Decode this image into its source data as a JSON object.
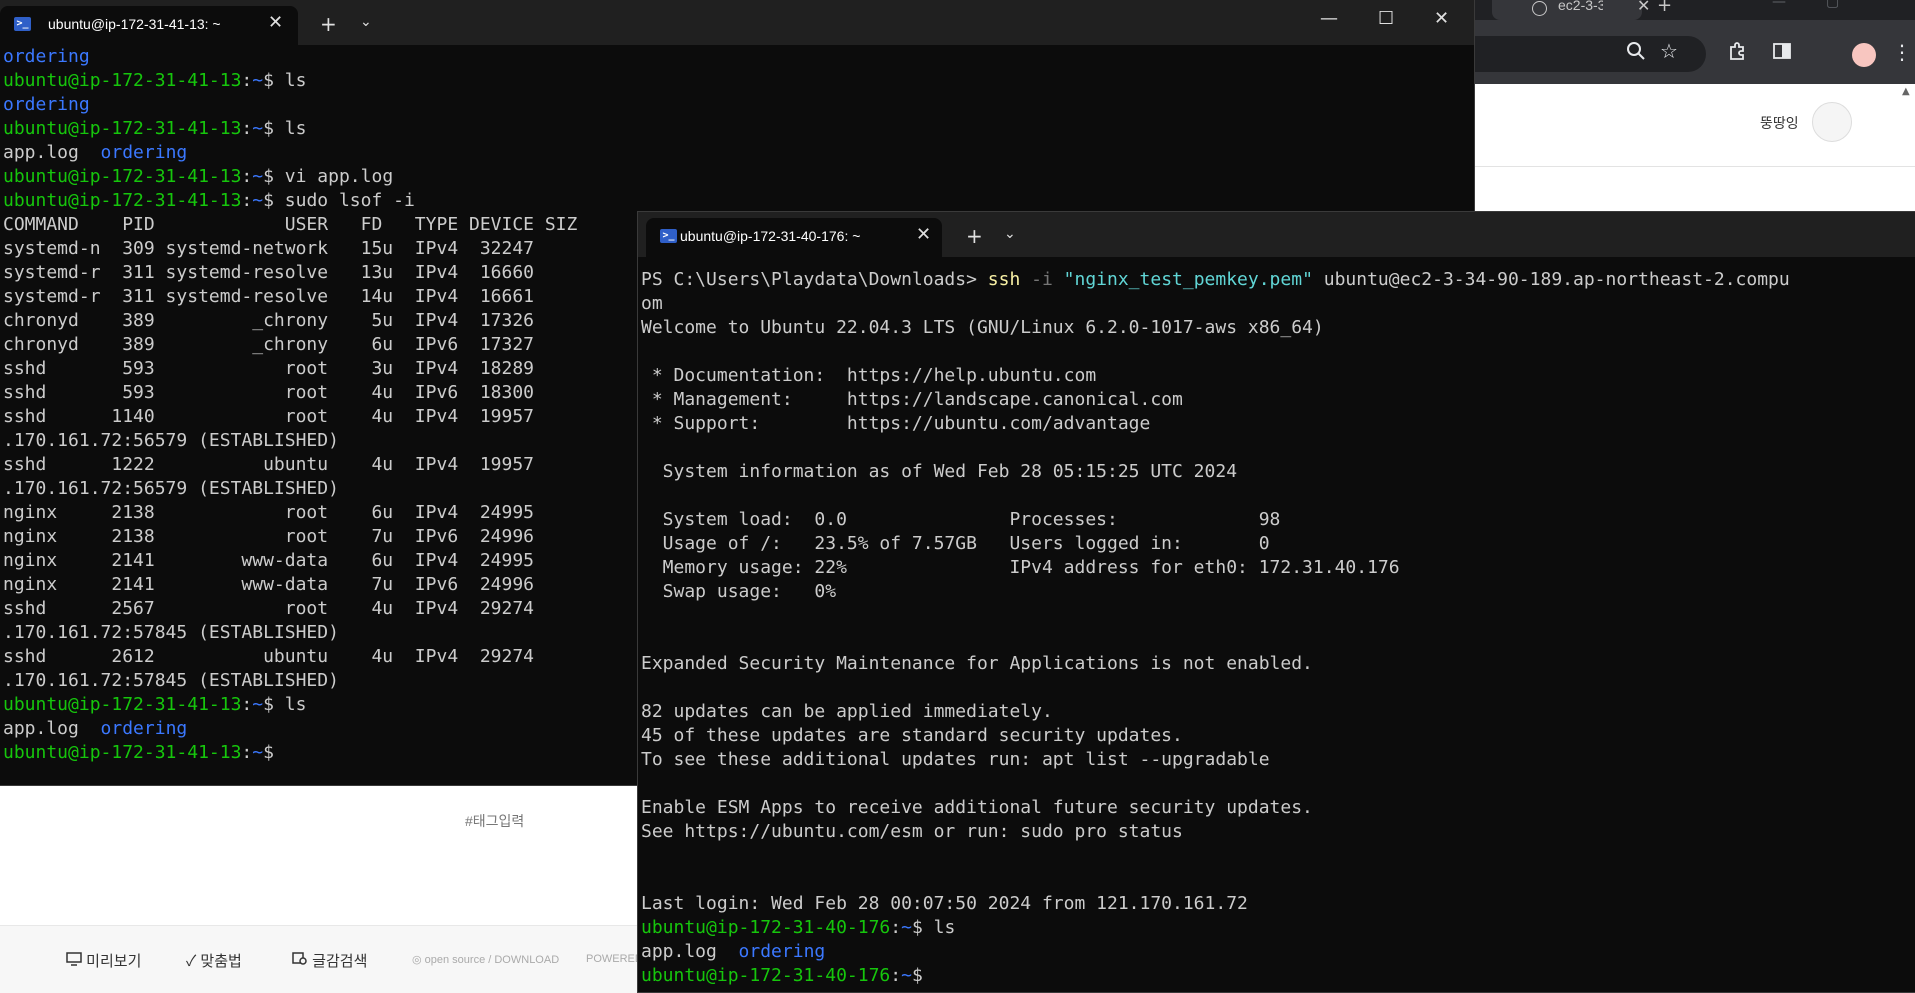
{
  "browser": {
    "tab_title": "ec2-3-3",
    "username": "뚱땅잉",
    "tag_placeholder": "#태그입력",
    "footer": {
      "preview": "미리보기",
      "spellcheck": "맞춤법",
      "search": "글감검색",
      "opensource": "open source / DOWNLOAD",
      "powered": "POWERED"
    }
  },
  "terminal1": {
    "tab_title": "ubuntu@ip-172-31-41-13: ~",
    "lines": [
      [
        {
          "t": "ordering",
          "c": "b"
        }
      ],
      [
        {
          "t": "ubuntu@ip-172-31-41-13",
          "c": "g"
        },
        {
          "t": ":",
          "c": "c"
        },
        {
          "t": "~",
          "c": "b"
        },
        {
          "t": "$ ls",
          "c": "c"
        }
      ],
      [
        {
          "t": "ordering",
          "c": "b"
        }
      ],
      [
        {
          "t": "ubuntu@ip-172-31-41-13",
          "c": "g"
        },
        {
          "t": ":",
          "c": "c"
        },
        {
          "t": "~",
          "c": "b"
        },
        {
          "t": "$ ls",
          "c": "c"
        }
      ],
      [
        {
          "t": "app.log  ",
          "c": "c"
        },
        {
          "t": "ordering",
          "c": "b"
        }
      ],
      [
        {
          "t": "ubuntu@ip-172-31-41-13",
          "c": "g"
        },
        {
          "t": ":",
          "c": "c"
        },
        {
          "t": "~",
          "c": "b"
        },
        {
          "t": "$ vi app.log",
          "c": "c"
        }
      ],
      [
        {
          "t": "ubuntu@ip-172-31-41-13",
          "c": "g"
        },
        {
          "t": ":",
          "c": "c"
        },
        {
          "t": "~",
          "c": "b"
        },
        {
          "t": "$ sudo lsof -i",
          "c": "c"
        }
      ],
      [
        {
          "t": "COMMAND    PID            USER   FD   TYPE DEVICE SIZ",
          "c": "c"
        }
      ],
      [
        {
          "t": "systemd-n  309 systemd-network   15u  IPv4  32247",
          "c": "c"
        }
      ],
      [
        {
          "t": "systemd-r  311 systemd-resolve   13u  IPv4  16660",
          "c": "c"
        }
      ],
      [
        {
          "t": "systemd-r  311 systemd-resolve   14u  IPv4  16661",
          "c": "c"
        }
      ],
      [
        {
          "t": "chronyd    389         _chrony    5u  IPv4  17326",
          "c": "c"
        }
      ],
      [
        {
          "t": "chronyd    389         _chrony    6u  IPv6  17327",
          "c": "c"
        }
      ],
      [
        {
          "t": "sshd       593            root    3u  IPv4  18289",
          "c": "c"
        }
      ],
      [
        {
          "t": "sshd       593            root    4u  IPv6  18300",
          "c": "c"
        }
      ],
      [
        {
          "t": "sshd      1140            root    4u  IPv4  19957",
          "c": "c"
        }
      ],
      [
        {
          "t": ".170.161.72:56579 (ESTABLISHED)",
          "c": "c"
        }
      ],
      [
        {
          "t": "sshd      1222          ubuntu    4u  IPv4  19957",
          "c": "c"
        }
      ],
      [
        {
          "t": ".170.161.72:56579 (ESTABLISHED)",
          "c": "c"
        }
      ],
      [
        {
          "t": "nginx     2138            root    6u  IPv4  24995",
          "c": "c"
        }
      ],
      [
        {
          "t": "nginx     2138            root    7u  IPv6  24996",
          "c": "c"
        }
      ],
      [
        {
          "t": "nginx     2141        www-data    6u  IPv4  24995",
          "c": "c"
        }
      ],
      [
        {
          "t": "nginx     2141        www-data    7u  IPv6  24996",
          "c": "c"
        }
      ],
      [
        {
          "t": "sshd      2567            root    4u  IPv4  29274",
          "c": "c"
        }
      ],
      [
        {
          "t": ".170.161.72:57845 (ESTABLISHED)",
          "c": "c"
        }
      ],
      [
        {
          "t": "sshd      2612          ubuntu    4u  IPv4  29274",
          "c": "c"
        }
      ],
      [
        {
          "t": ".170.161.72:57845 (ESTABLISHED)",
          "c": "c"
        }
      ],
      [
        {
          "t": "ubuntu@ip-172-31-41-13",
          "c": "g"
        },
        {
          "t": ":",
          "c": "c"
        },
        {
          "t": "~",
          "c": "b"
        },
        {
          "t": "$ ls",
          "c": "c"
        }
      ],
      [
        {
          "t": "app.log  ",
          "c": "c"
        },
        {
          "t": "ordering",
          "c": "b"
        }
      ],
      [
        {
          "t": "ubuntu@ip-172-31-41-13",
          "c": "g"
        },
        {
          "t": ":",
          "c": "c"
        },
        {
          "t": "~",
          "c": "b"
        },
        {
          "t": "$",
          "c": "c"
        }
      ]
    ]
  },
  "terminal2": {
    "tab_title": "ubuntu@ip-172-31-40-176: ~",
    "lines": [
      [
        {
          "t": "PS C:\\Users\\Playdata\\Downloads> ",
          "c": "c"
        },
        {
          "t": "ssh",
          "c": "y"
        },
        {
          "t": " -i ",
          "c": "gr"
        },
        {
          "t": "\"nginx_test_pemkey.pem\"",
          "c": "s"
        },
        {
          "t": " ubuntu@ec2-3-34-90-189.ap-northeast-2.compu",
          "c": "c"
        }
      ],
      [
        {
          "t": "om",
          "c": "c"
        }
      ],
      [
        {
          "t": "Welcome to Ubuntu 22.04.3 LTS (GNU/Linux 6.2.0-1017-aws x86_64)",
          "c": "c"
        }
      ],
      [
        {
          "t": "",
          "c": "c"
        }
      ],
      [
        {
          "t": " * Documentation:  https://help.ubuntu.com",
          "c": "c"
        }
      ],
      [
        {
          "t": " * Management:     https://landscape.canonical.com",
          "c": "c"
        }
      ],
      [
        {
          "t": " * Support:        https://ubuntu.com/advantage",
          "c": "c"
        }
      ],
      [
        {
          "t": "",
          "c": "c"
        }
      ],
      [
        {
          "t": "  System information as of Wed Feb 28 05:15:25 UTC 2024",
          "c": "c"
        }
      ],
      [
        {
          "t": "",
          "c": "c"
        }
      ],
      [
        {
          "t": "  System load:  0.0               Processes:             98",
          "c": "c"
        }
      ],
      [
        {
          "t": "  Usage of /:   23.5% of 7.57GB   Users logged in:       0",
          "c": "c"
        }
      ],
      [
        {
          "t": "  Memory usage: 22%               IPv4 address for eth0: 172.31.40.176",
          "c": "c"
        }
      ],
      [
        {
          "t": "  Swap usage:   0%",
          "c": "c"
        }
      ],
      [
        {
          "t": "",
          "c": "c"
        }
      ],
      [
        {
          "t": "",
          "c": "c"
        }
      ],
      [
        {
          "t": "Expanded Security Maintenance for Applications is not enabled.",
          "c": "c"
        }
      ],
      [
        {
          "t": "",
          "c": "c"
        }
      ],
      [
        {
          "t": "82 updates can be applied immediately.",
          "c": "c"
        }
      ],
      [
        {
          "t": "45 of these updates are standard security updates.",
          "c": "c"
        }
      ],
      [
        {
          "t": "To see these additional updates run: apt list --upgradable",
          "c": "c"
        }
      ],
      [
        {
          "t": "",
          "c": "c"
        }
      ],
      [
        {
          "t": "Enable ESM Apps to receive additional future security updates.",
          "c": "c"
        }
      ],
      [
        {
          "t": "See https://ubuntu.com/esm or run: sudo pro status",
          "c": "c"
        }
      ],
      [
        {
          "t": "",
          "c": "c"
        }
      ],
      [
        {
          "t": "",
          "c": "c"
        }
      ],
      [
        {
          "t": "Last login: Wed Feb 28 00:07:50 2024 from 121.170.161.72",
          "c": "c"
        }
      ],
      [
        {
          "t": "ubuntu@ip-172-31-40-176",
          "c": "g"
        },
        {
          "t": ":",
          "c": "c"
        },
        {
          "t": "~",
          "c": "b"
        },
        {
          "t": "$ ls",
          "c": "c"
        }
      ],
      [
        {
          "t": "app.log  ",
          "c": "c"
        },
        {
          "t": "ordering",
          "c": "b"
        }
      ],
      [
        {
          "t": "ubuntu@ip-172-31-40-176",
          "c": "g"
        },
        {
          "t": ":",
          "c": "c"
        },
        {
          "t": "~",
          "c": "b"
        },
        {
          "t": "$",
          "c": "c"
        }
      ]
    ]
  },
  "colors": {
    "terminal_bg": "#0c0c0c",
    "prompt_green": "#16c60c",
    "dir_blue": "#3b78ff",
    "titlebar": "#202020"
  },
  "icons": [
    "powershell-icon",
    "close-icon",
    "plus-icon",
    "chevron-down-icon",
    "minimize-icon",
    "maximize-icon",
    "zoom-icon",
    "star-icon",
    "extensions-icon",
    "sidepanel-icon",
    "menu-icon"
  ]
}
